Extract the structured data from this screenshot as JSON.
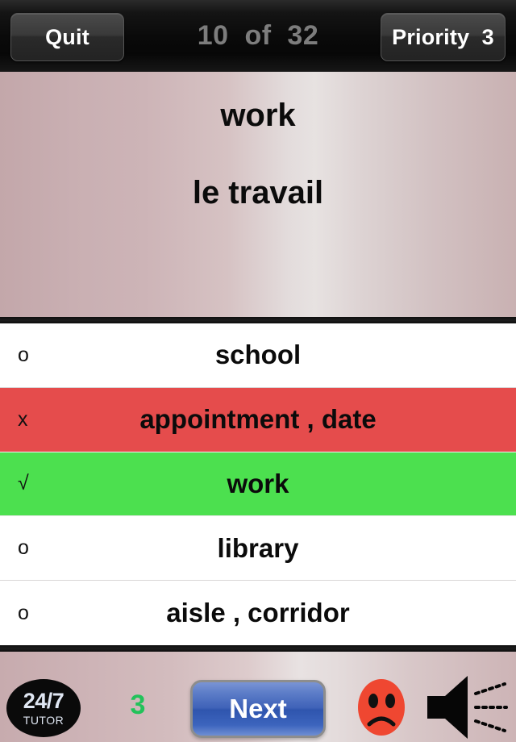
{
  "topbar": {
    "quit_label": "Quit",
    "counter_text": "10  of  32",
    "counter_current": 10,
    "counter_total": 32,
    "priority_label": "Priority  3",
    "priority_value": 3
  },
  "prompt": {
    "term": "work",
    "translation": "le travail"
  },
  "answers": [
    {
      "mark": "o",
      "text": "school",
      "state": "neutral"
    },
    {
      "mark": "x",
      "text": "appointment , date",
      "state": "wrong"
    },
    {
      "mark": "√",
      "text": "work",
      "state": "correct"
    },
    {
      "mark": "o",
      "text": "library",
      "state": "neutral"
    },
    {
      "mark": "o",
      "text": "aisle , corridor",
      "state": "neutral"
    }
  ],
  "bottombar": {
    "logo_primary": "24/7",
    "logo_secondary": "TUTOR",
    "score": "3",
    "next_label": "Next",
    "mood_icon": "sad-face-icon",
    "speaker_icon": "speaker-icon"
  },
  "colors": {
    "wrong": "#e54c4c",
    "correct": "#4ce04f",
    "score": "#22c25a",
    "next_button": "#2f55ae",
    "mood": "#ef4731",
    "topbar": "#0a0a0a"
  }
}
